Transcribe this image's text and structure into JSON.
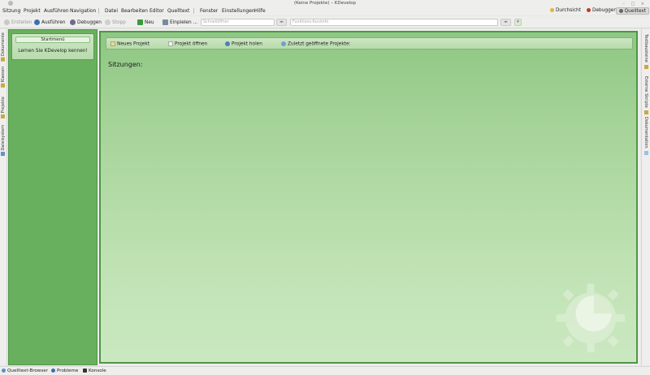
{
  "window": {
    "title": "(Keine Projekte) – KDevelop"
  },
  "menu": {
    "items": [
      "Sitzung",
      "Projekt",
      "Ausführen",
      "Navigation",
      "Datei",
      "Bearbeiten",
      "Editor",
      "Quelltext",
      "Fenster",
      "Einstellungen",
      "Hilfe"
    ]
  },
  "perspectives": {
    "review": "Durchsicht",
    "debug": "Debuggen",
    "code": "Quelltext"
  },
  "toolbar": {
    "build": "Erstellen",
    "run": "Ausführen",
    "debug": "Debuggen",
    "stop": "Stopp",
    "new": "Neu",
    "paste": "Einpielen ...",
    "quickopen_placeholder": "Schnellöffner",
    "function_placeholder": "Funktions-Kurzinfo"
  },
  "left_dock": {
    "tabs": [
      "Dokumente",
      "Klassen",
      "Projekte",
      "Dateisystem"
    ]
  },
  "right_dock": {
    "tabs": [
      "Textbausteine",
      "Externe Skripte",
      "Dokumentation"
    ]
  },
  "start_menu": {
    "title": "Startmenü",
    "learn": "Lernen Sie KDevelop kennen!"
  },
  "actions": {
    "new_project": "Neues Projekt",
    "open_project": "Projekt öffnen",
    "fetch_project": "Projekt holen",
    "recent_projects": "Zuletzt geöffnete Projekte:"
  },
  "sessions_label": "Sitzungen:",
  "statusbar": {
    "items": [
      "Quelltext-Browser",
      "Probleme",
      "Konsole"
    ]
  },
  "colors": {
    "panel_green": "#68b05e",
    "content_green_top": "#8ec783",
    "content_green_bottom": "#cbe8c1"
  }
}
